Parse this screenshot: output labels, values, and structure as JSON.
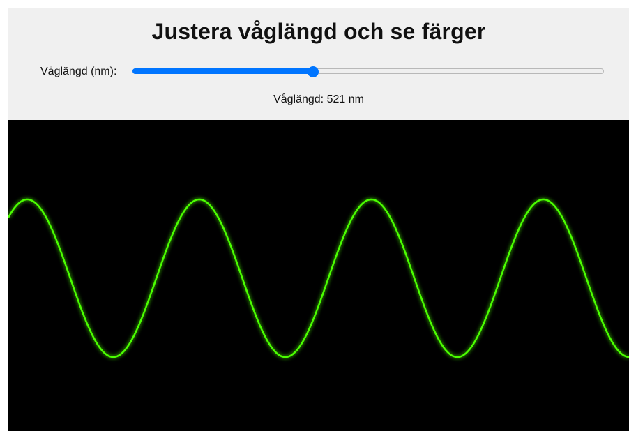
{
  "header": {
    "title": "Justera våglängd och se färger"
  },
  "controls": {
    "slider_label": "Våglängd (nm):",
    "slider_min": 380,
    "slider_max": 750,
    "slider_value": 521
  },
  "readout": {
    "text": "Våglängd: 521 nm"
  },
  "wave": {
    "color": "#4cff00",
    "background": "#000000"
  },
  "colors": {
    "accent": "#0075ff",
    "panel": "#f0f0f0"
  }
}
